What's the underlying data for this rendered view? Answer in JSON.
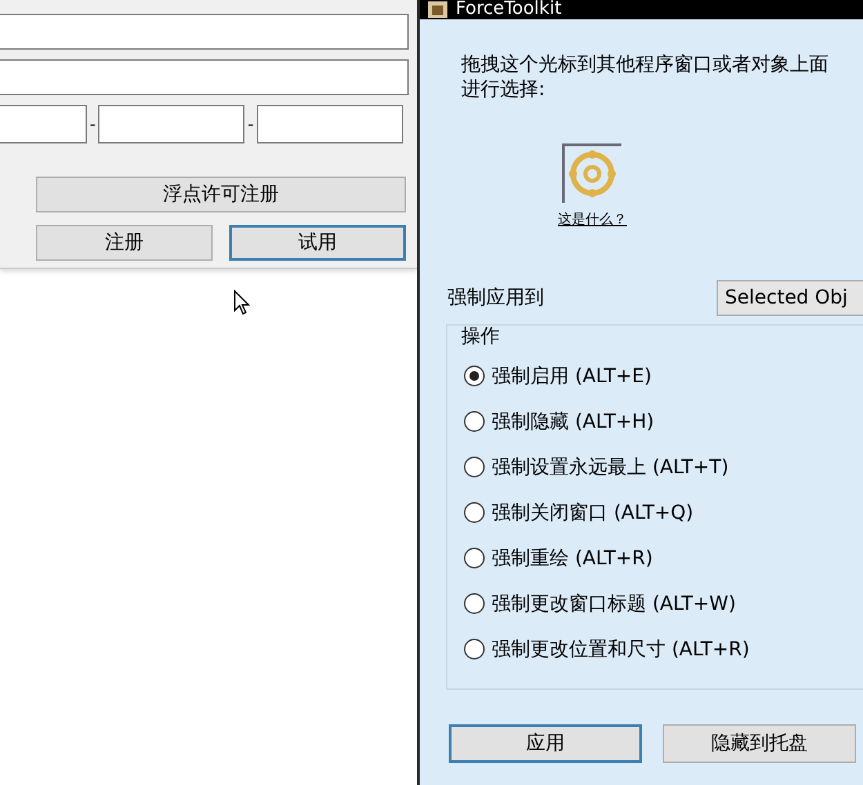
{
  "license_window": {
    "serial_separators": [
      "-",
      "-"
    ],
    "buttons": [
      {
        "label": "浮点许可注册",
        "focused": false
      },
      {
        "label": "注册",
        "focused": false
      },
      {
        "label": "试用",
        "focused": true
      }
    ]
  },
  "force_toolkit": {
    "title": "ForceToolkit",
    "instruction": "拖拽这个光标到其他程序窗口或者对象上面进行选择:",
    "help_link": "这是什么？",
    "apply_to_label": "强制应用到",
    "apply_to_value": "Selected Obj",
    "group_label": "操作",
    "options": [
      {
        "label": "强制启用 (ALT+E)",
        "selected": true
      },
      {
        "label": "强制隐藏 (ALT+H)",
        "selected": false
      },
      {
        "label": "强制设置永远最上 (ALT+T)",
        "selected": false
      },
      {
        "label": "强制关闭窗口 (ALT+Q)",
        "selected": false
      },
      {
        "label": "强制重绘 (ALT+R)",
        "selected": false
      },
      {
        "label": "强制更改窗口标题 (ALT+W)",
        "selected": false
      },
      {
        "label": "强制更改位置和尺寸 (ALT+R)",
        "selected": false
      }
    ],
    "buttons": [
      {
        "label": "应用",
        "focused": true
      },
      {
        "label": "隐藏到托盘",
        "focused": false
      }
    ]
  }
}
